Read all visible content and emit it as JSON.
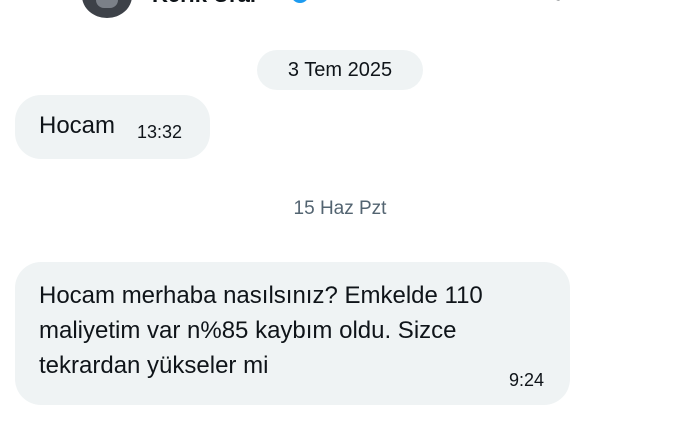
{
  "header": {
    "contact_name": "Kerik Ural",
    "icons": [
      "back-arrow-icon",
      "verified-badge-icon",
      "call-icon",
      "video-call-icon"
    ]
  },
  "conversation": {
    "date_pill": "3 Tem 2025",
    "messages_group_1": [
      {
        "text": "Hocam",
        "time": "13:32"
      }
    ],
    "date_separator": "15 Haz Pzt",
    "messages_group_2": [
      {
        "text": "Hocam merhaba nasılsınız? Emkelde 110 maliyetim var n%85 kaybım oldu. Sizce tekrardan yükseler mi",
        "time": "9:24"
      }
    ]
  },
  "colors": {
    "bubble_bg": "#eff3f4",
    "text_primary": "#0f1419",
    "text_secondary": "#536471",
    "verified_blue": "#1d9bf0"
  }
}
